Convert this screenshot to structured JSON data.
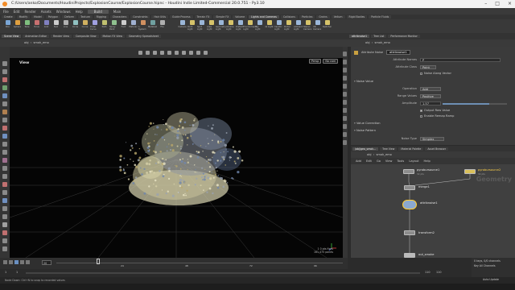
{
  "window": {
    "title": "C:/Users/anko/Documents/HoudiniProjects/ExplosionCourse/ExplosionCourse.hipnc - Houdini Indie Limited-Commercial 20.0.751 - Py3.10"
  },
  "menubar": {
    "items": [
      "File",
      "Edit",
      "Render",
      "Assets",
      "Windows",
      "Help"
    ],
    "desktop": "Build",
    "context": "Main"
  },
  "shelf_tabs": [
    "Create",
    "Modify",
    "Model",
    "Polygon",
    "Deform",
    "Texture",
    "Rigging",
    "Characters",
    "Constraints",
    "Hair Utils",
    "Guide Process",
    "Terrain FX",
    "Simple FX",
    "Volume",
    "Lights and Cameras",
    "Collisions",
    "Particles",
    "Grains",
    "Vellum",
    "Rigid Bodies",
    "Particle Fluids",
    "Viscous Fluids",
    "Oceans",
    "Pyro FX",
    "FEM",
    "Wires",
    "Crowds",
    "Drive Simulation"
  ],
  "shelf_tools": [
    "Box",
    "Sphere",
    "Tube",
    "Torus",
    "Grid",
    "Null",
    "Line",
    "Circle",
    "Curve",
    "Draw Curve",
    "Path",
    "Spray Paint",
    "Font",
    "Platonic",
    "L-System",
    "Metaball",
    "File"
  ],
  "light_tools": [
    "Camera",
    "Point Light",
    "Spot Light",
    "Area Light",
    "Geometry Light",
    "Volume Light",
    "Distant Light",
    "Environment Light",
    "Sky Light",
    "GI Light",
    "Caustic Light",
    "Portal Light",
    "Ambient Light",
    "Stereo Camera",
    "VR Camera",
    "Switcher"
  ],
  "pane_tabs": [
    "Scene View",
    "Animation Editor",
    "Render View",
    "Composite View",
    "Motion FX View",
    "Geometry Spreadsheet"
  ],
  "path": {
    "obj": "obj",
    "node": "smok_emo"
  },
  "viewport": {
    "label": "View",
    "camera": "Persp",
    "cam_menu": "No cam",
    "stats": [
      "1 0  pts fixes",
      "161,475 points"
    ]
  },
  "right_tabs": [
    "attribnoise1",
    "Tree List",
    "Performance Monitor"
  ],
  "params": {
    "node_type": "Attribute Noise",
    "node_name": "attribnoise1",
    "attribute_names_label": "Attribute Names",
    "attribute_names_value": "P",
    "attribute_class_label": "Attribute Class",
    "attribute_class_value": "Point",
    "noise_along_vector": "Noise Along Vector",
    "sec_noise_value": "Noise Value",
    "operation_label": "Operation",
    "operation_value": "Add",
    "range_values_label": "Range Values",
    "range_values_value": "Positive",
    "amplitude_label": "Amplitude",
    "amplitude_value": "1.57",
    "amplitude_frac": 0.72,
    "output_raw": "Output Raw Value",
    "enable_remap": "Enable Remap Ramp",
    "sec_value_correction": "Value Correction",
    "sec_noise_pattern": "Noise Pattern",
    "noise_type_label": "Noise Type",
    "noise_type_value": "Simplex"
  },
  "network_tabs": [
    "/obj/geo_smok...",
    "Tree View",
    "Material Palette",
    "Asset Browser"
  ],
  "network_menu": [
    "Add",
    "Edit",
    "Go",
    "View",
    "Tools",
    "Layout",
    "Help"
  ],
  "network_watermark": "Geometry",
  "nodes": {
    "pyrosource1": "pyrobursource1",
    "pyrosource2": "pyrobursource2",
    "merge": "merge1",
    "noise": "attribnoise1",
    "transform": "transform2",
    "out": "out_smoke",
    "sub1": "32 pts",
    "sub2": "32 pts"
  },
  "timeline": {
    "frame": "20",
    "start": "1",
    "end": "1",
    "range_end": "110",
    "range_end2": "110",
    "ticks": [
      "24",
      "48",
      "72",
      "96"
    ]
  },
  "lower_right": {
    "keys": "0 keys, 0/0 channels",
    "key_all": "Key All Channels",
    "auto_update": "Auto Update"
  },
  "status": "Node Down: Ctrl+N to snap to recorded values",
  "colors": {
    "accent": "#f28c28",
    "selected": "#ffcc33",
    "viewport_bg": "#050505"
  }
}
